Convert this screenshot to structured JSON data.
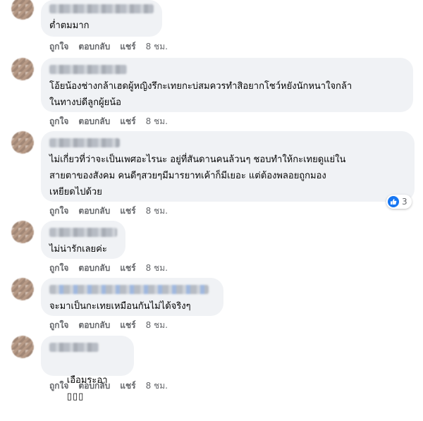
{
  "action_labels": {
    "like": "ถูกใจ",
    "reply": "ตอบกลับ",
    "share": "แชร์",
    "time": "8 ชม."
  },
  "comments": [
    {
      "text": "ต่ำตมมาก"
    },
    {
      "text": "โอ้ยน้องช่างกล้าเฮดผู้หญิงรึกะเทยกะบ่สมควรทำสิอยากโชว์หยังนักหนาใจกล้า\nในทางบ่ดีลูกผู้ยน้อ"
    },
    {
      "text": "ไม่เกี่ยวที่ว่าจะเป็นเพศอะไรนะ อยู่ที่สันดานคนล้วนๆ ชอบทำให้กะเทยดูแย่ใน\nสายตาของสังคม คนดีๆสวยๆมีมารยาทเค้าก็มีเยอะ แต่ต้องพลอยถูกมอง\nเหยียดไปด้วย",
      "reaction_count": "3"
    },
    {
      "text": "ไม่น่ารักเลยค่ะ"
    },
    {
      "text": "จะมาเป็นกะเทยเหมือนกันไม่ได้จริงๆ"
    },
    {
      "text": "เอือมระอา",
      "emoji_boxes": "▯▯▯"
    }
  ],
  "colors": {
    "bubble": "#f0f2f5",
    "meta_text": "#65676b",
    "like_blue": "#1877f2"
  },
  "icons": [
    "like-icon"
  ]
}
